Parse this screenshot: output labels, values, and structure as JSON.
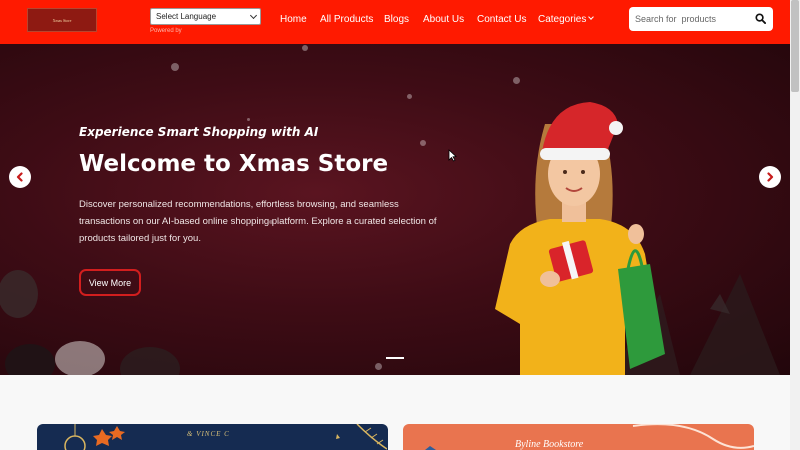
{
  "header": {
    "logo_text": "Xmas Store",
    "language_select": "Select Language",
    "powered_by": "Powered by",
    "nav": [
      "Home",
      "All Products",
      "Blogs",
      "About Us",
      "Contact Us",
      "Categories"
    ],
    "search_placeholder": "Search for  products",
    "accent_color": "#ff1a00"
  },
  "hero": {
    "tagline": "Experience Smart Shopping with AI",
    "title": "Welcome to Xmas Store",
    "description": "Discover personalized recommendations, effortless browsing, and seamless transactions on our AI-based online shopping platform. Explore a curated selection of products tailored just for you.",
    "button_label": "View More",
    "prev_icon": "chevron-left-icon",
    "next_icon": "chevron-right-icon"
  },
  "cards": [
    {
      "text": "& VINCE C"
    },
    {
      "text": "Byline Bookstore"
    }
  ]
}
